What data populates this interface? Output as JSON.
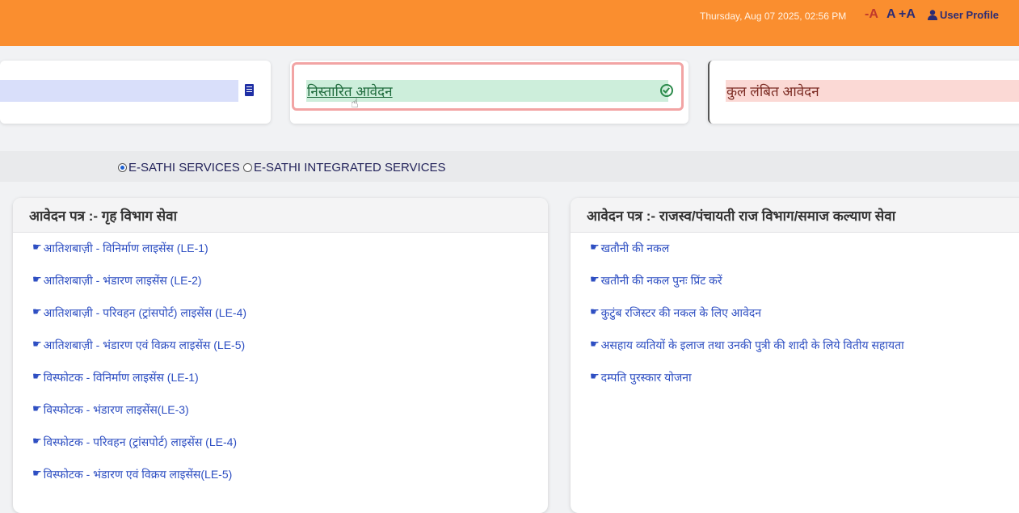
{
  "header": {
    "datetime": "Thursday, Aug 07 2025, 02:56 PM",
    "font_decrease": "-A",
    "font_normal": "A",
    "font_increase": "+A",
    "user_profile": "User Profile"
  },
  "cards": {
    "disposed_label": "निस्तारित आवेदन",
    "pending_label": "कुल लंबित आवेदन"
  },
  "service_type": {
    "option1": "E-SATHI SERVICES",
    "option2": "E-SATHI INTEGRATED SERVICES",
    "selected": "E-SATHI SERVICES"
  },
  "left_panel": {
    "title": "आवेदन पत्र :-  गृह विभाग सेवा",
    "items": [
      "आतिशबाज़ी - विनिर्माण लाइसेंस (LE-1)",
      "आतिशबाज़ी - भंडारण लाइसेंस (LE-2)",
      "आतिशबाज़ी - परिवहन (ट्रांसपोर्ट) लाइसेंस (LE-4)",
      "आतिशबाज़ी - भंडारण एवं विक्रय लाइसेंस (LE-5)",
      "विस्फोटक - विनिर्माण लाइसेंस (LE-1)",
      "विस्फोटक - भंडारण लाइसेंस(LE-3)",
      "विस्फोटक - परिवहन (ट्रांसपोर्ट) लाइसेंस (LE-4)",
      "विस्फोटक - भंडारण एवं विक्रय लाइसेंस(LE-5)"
    ]
  },
  "right_panel": {
    "title": "आवेदन पत्र :-  राजस्व/पंचायती राज विभाग/समाज कल्याण सेवा",
    "items": [
      "खतौनी की नकल",
      "खतौनी की नकल पुनः प्रिंट करें",
      "कुटुंब रजिस्टर की नकल के लिए आवेदन",
      "असहाय व्यतियों के इलाज तथा उनकी पुत्री की शादी के लिये वितीय सहायता",
      "दम्पति पुरस्कार योजना"
    ]
  }
}
